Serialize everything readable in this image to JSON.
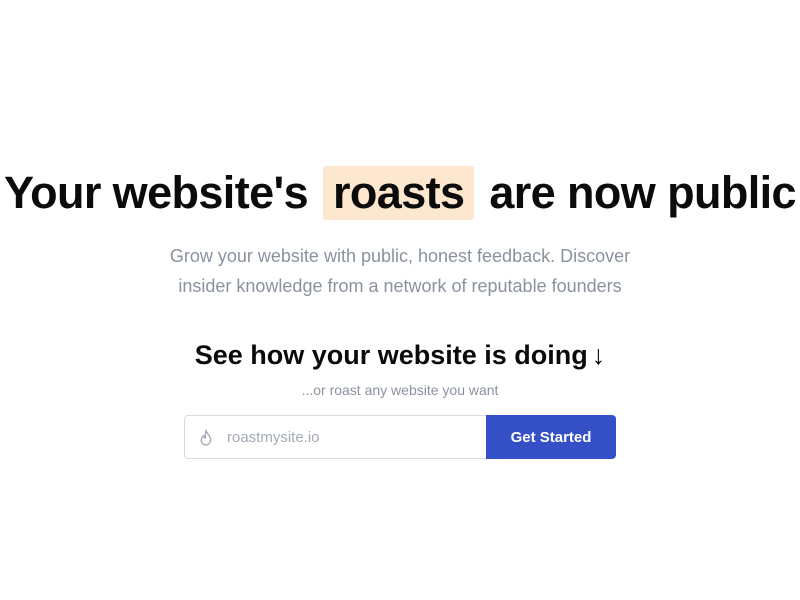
{
  "hero": {
    "title_before": "Your website's",
    "title_highlight": "roasts",
    "title_after": "are now public",
    "subtitle_line1": "Grow your website with public, honest feedback. Discover",
    "subtitle_line2": "insider knowledge from a network of reputable founders"
  },
  "cta": {
    "heading": "See how your website is doing",
    "heading_arrow": "↓",
    "subheading": "...or roast any website you want",
    "input_placeholder": "roastmysite.io",
    "input_value": "",
    "input_icon": "flame-icon",
    "button_label": "Get Started"
  },
  "colors": {
    "highlight_bg": "#fde8cf",
    "button_bg": "#3550c7",
    "muted_text": "#8a929f",
    "heading_text": "#0b0b0b"
  }
}
